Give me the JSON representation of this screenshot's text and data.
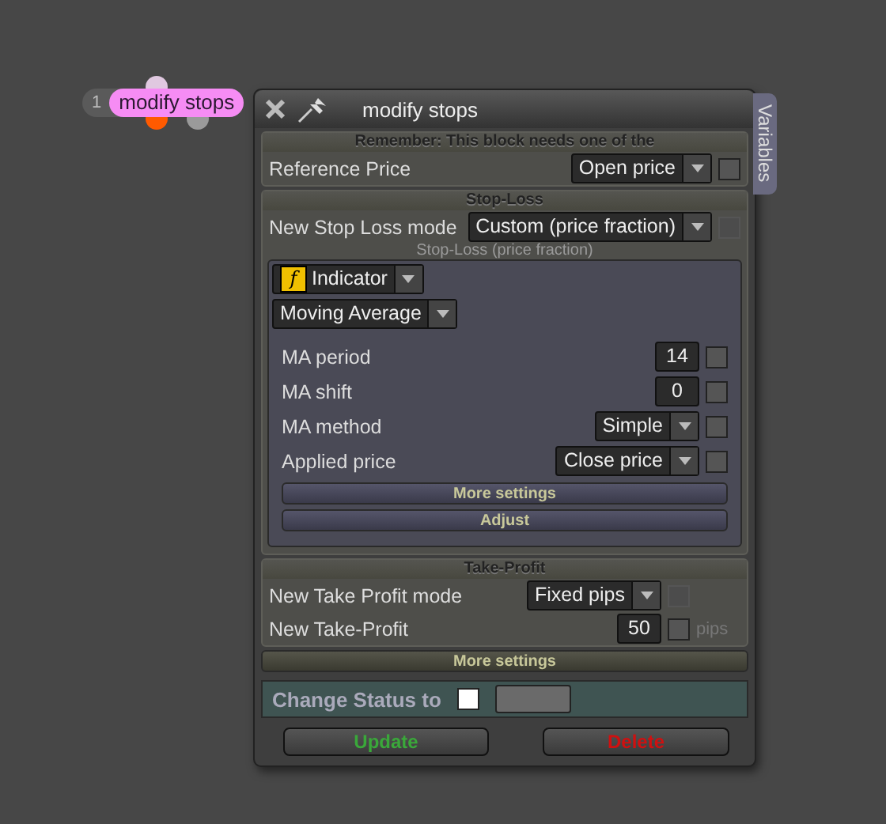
{
  "node": {
    "number": "1",
    "label": "modify stops"
  },
  "window": {
    "title": "modify stops",
    "side_tab": "Variables"
  },
  "notice": "Remember: This block needs one of the",
  "reference": {
    "label": "Reference Price",
    "value": "Open price",
    "checked": false,
    "disabled": false
  },
  "stop_loss": {
    "heading": "Stop-Loss",
    "mode_label": "New Stop Loss mode",
    "mode_value": "Custom (price fraction)",
    "mode_checked": false,
    "mode_disabled": true,
    "sub_heading": "Stop-Loss (price fraction)",
    "source_icon": "f",
    "source": "Indicator",
    "indicator": "Moving Average",
    "params": [
      {
        "kind": "number",
        "label": "MA period",
        "value": "14",
        "checked": false
      },
      {
        "kind": "number",
        "label": "MA shift",
        "value": "0",
        "checked": false
      },
      {
        "kind": "select",
        "label": "MA method",
        "value": "Simple",
        "checked": false
      },
      {
        "kind": "select",
        "label": "Applied price",
        "value": "Close price",
        "checked": false
      }
    ],
    "buttons": [
      "More settings",
      "Adjust"
    ]
  },
  "take_profit": {
    "heading": "Take-Profit",
    "mode_label": "New Take Profit mode",
    "mode_value": "Fixed pips",
    "mode_checked": false,
    "mode_disabled": true,
    "value_label": "New Take-Profit",
    "value": "50",
    "value_checked": false,
    "unit": "pips"
  },
  "more_settings": "More settings",
  "status": {
    "label": "Change Status to",
    "checked": false
  },
  "actions": [
    {
      "kind": "update",
      "label": "Update"
    },
    {
      "kind": "delete",
      "label": "Delete"
    }
  ]
}
